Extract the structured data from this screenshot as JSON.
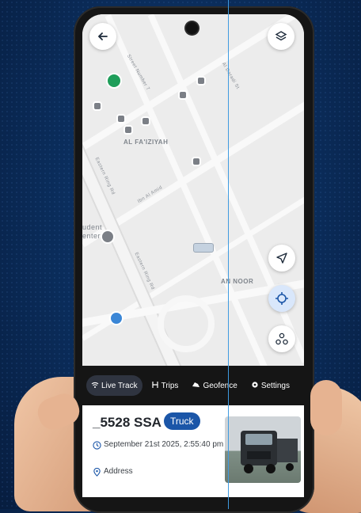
{
  "map": {
    "labels": {
      "district_1": "AL FA'IZIYAH",
      "district_2": "AN NOOR",
      "road_1": "Eastern Ring Rd",
      "road_2": "Eastern Ring Rd",
      "road_3": "Ibn Al Amid",
      "road_4": "Street Number 7",
      "road_5": "Al Daradi St",
      "place_1": "udent\nenter"
    }
  },
  "tabs": [
    {
      "label": "Live Track",
      "icon": "wifi-icon",
      "active": true
    },
    {
      "label": "Trips",
      "icon": "route-icon",
      "active": false
    },
    {
      "label": "Geofence",
      "icon": "geofence-icon",
      "active": false
    },
    {
      "label": "Settings",
      "icon": "gear-icon",
      "active": false
    }
  ],
  "vehicle": {
    "plate": "_5528 SSA",
    "type_badge": "Truck",
    "timestamp": "September 21st 2025, 2:55:40 pm",
    "address": "Address"
  },
  "colors": {
    "accent": "#1b56a8",
    "tab_bar": "#151515",
    "background": "#0a2b58"
  }
}
